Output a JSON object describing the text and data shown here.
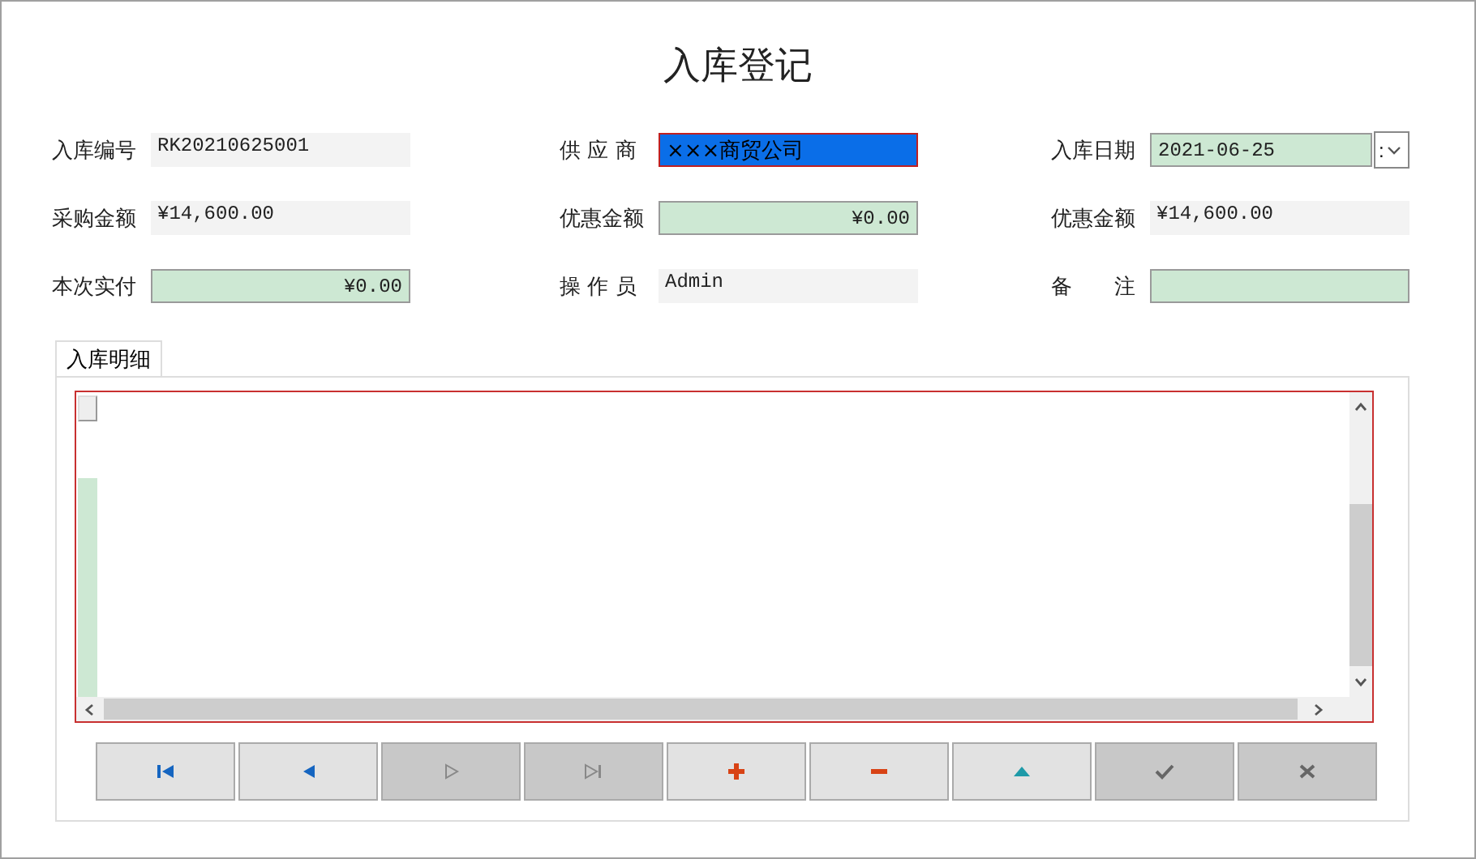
{
  "window": {
    "title": "入库登记"
  },
  "form_rows": [
    [
      {
        "label": "入库编号",
        "kind": "readonly",
        "value": "RK20210625001"
      },
      {
        "label": "供 应 商",
        "kind": "selected",
        "value": "×××商贸公司"
      },
      {
        "label": "入库日期",
        "kind": "date",
        "value": "2021-06-25",
        "suffix": ":"
      }
    ],
    [
      {
        "label": "采购金额",
        "kind": "readonly",
        "value": "¥14,600.00"
      },
      {
        "label": "优惠金额",
        "kind": "amount",
        "value": "¥0.00"
      },
      {
        "label": "优惠金额",
        "kind": "readonly",
        "value": "¥14,600.00"
      }
    ],
    [
      {
        "label": "本次实付",
        "kind": "amount",
        "value": "¥0.00"
      },
      {
        "label": "操 作 员",
        "kind": "readonly",
        "value": "Admin"
      },
      {
        "label": "备　　注",
        "kind": "editable"
      }
    ]
  ],
  "tabs": [
    {
      "label": "入库明细",
      "selected": true
    }
  ],
  "buttons": [
    {
      "kind": "first",
      "disabled": false
    },
    {
      "kind": "prev",
      "disabled": false
    },
    {
      "kind": "next",
      "disabled": true
    },
    {
      "kind": "last",
      "disabled": true
    },
    {
      "kind": "add",
      "disabled": false
    },
    {
      "kind": "remove",
      "disabled": false
    },
    {
      "kind": "up",
      "disabled": false
    },
    {
      "kind": "confirm",
      "disabled": true
    },
    {
      "kind": "cancel",
      "disabled": true
    }
  ]
}
